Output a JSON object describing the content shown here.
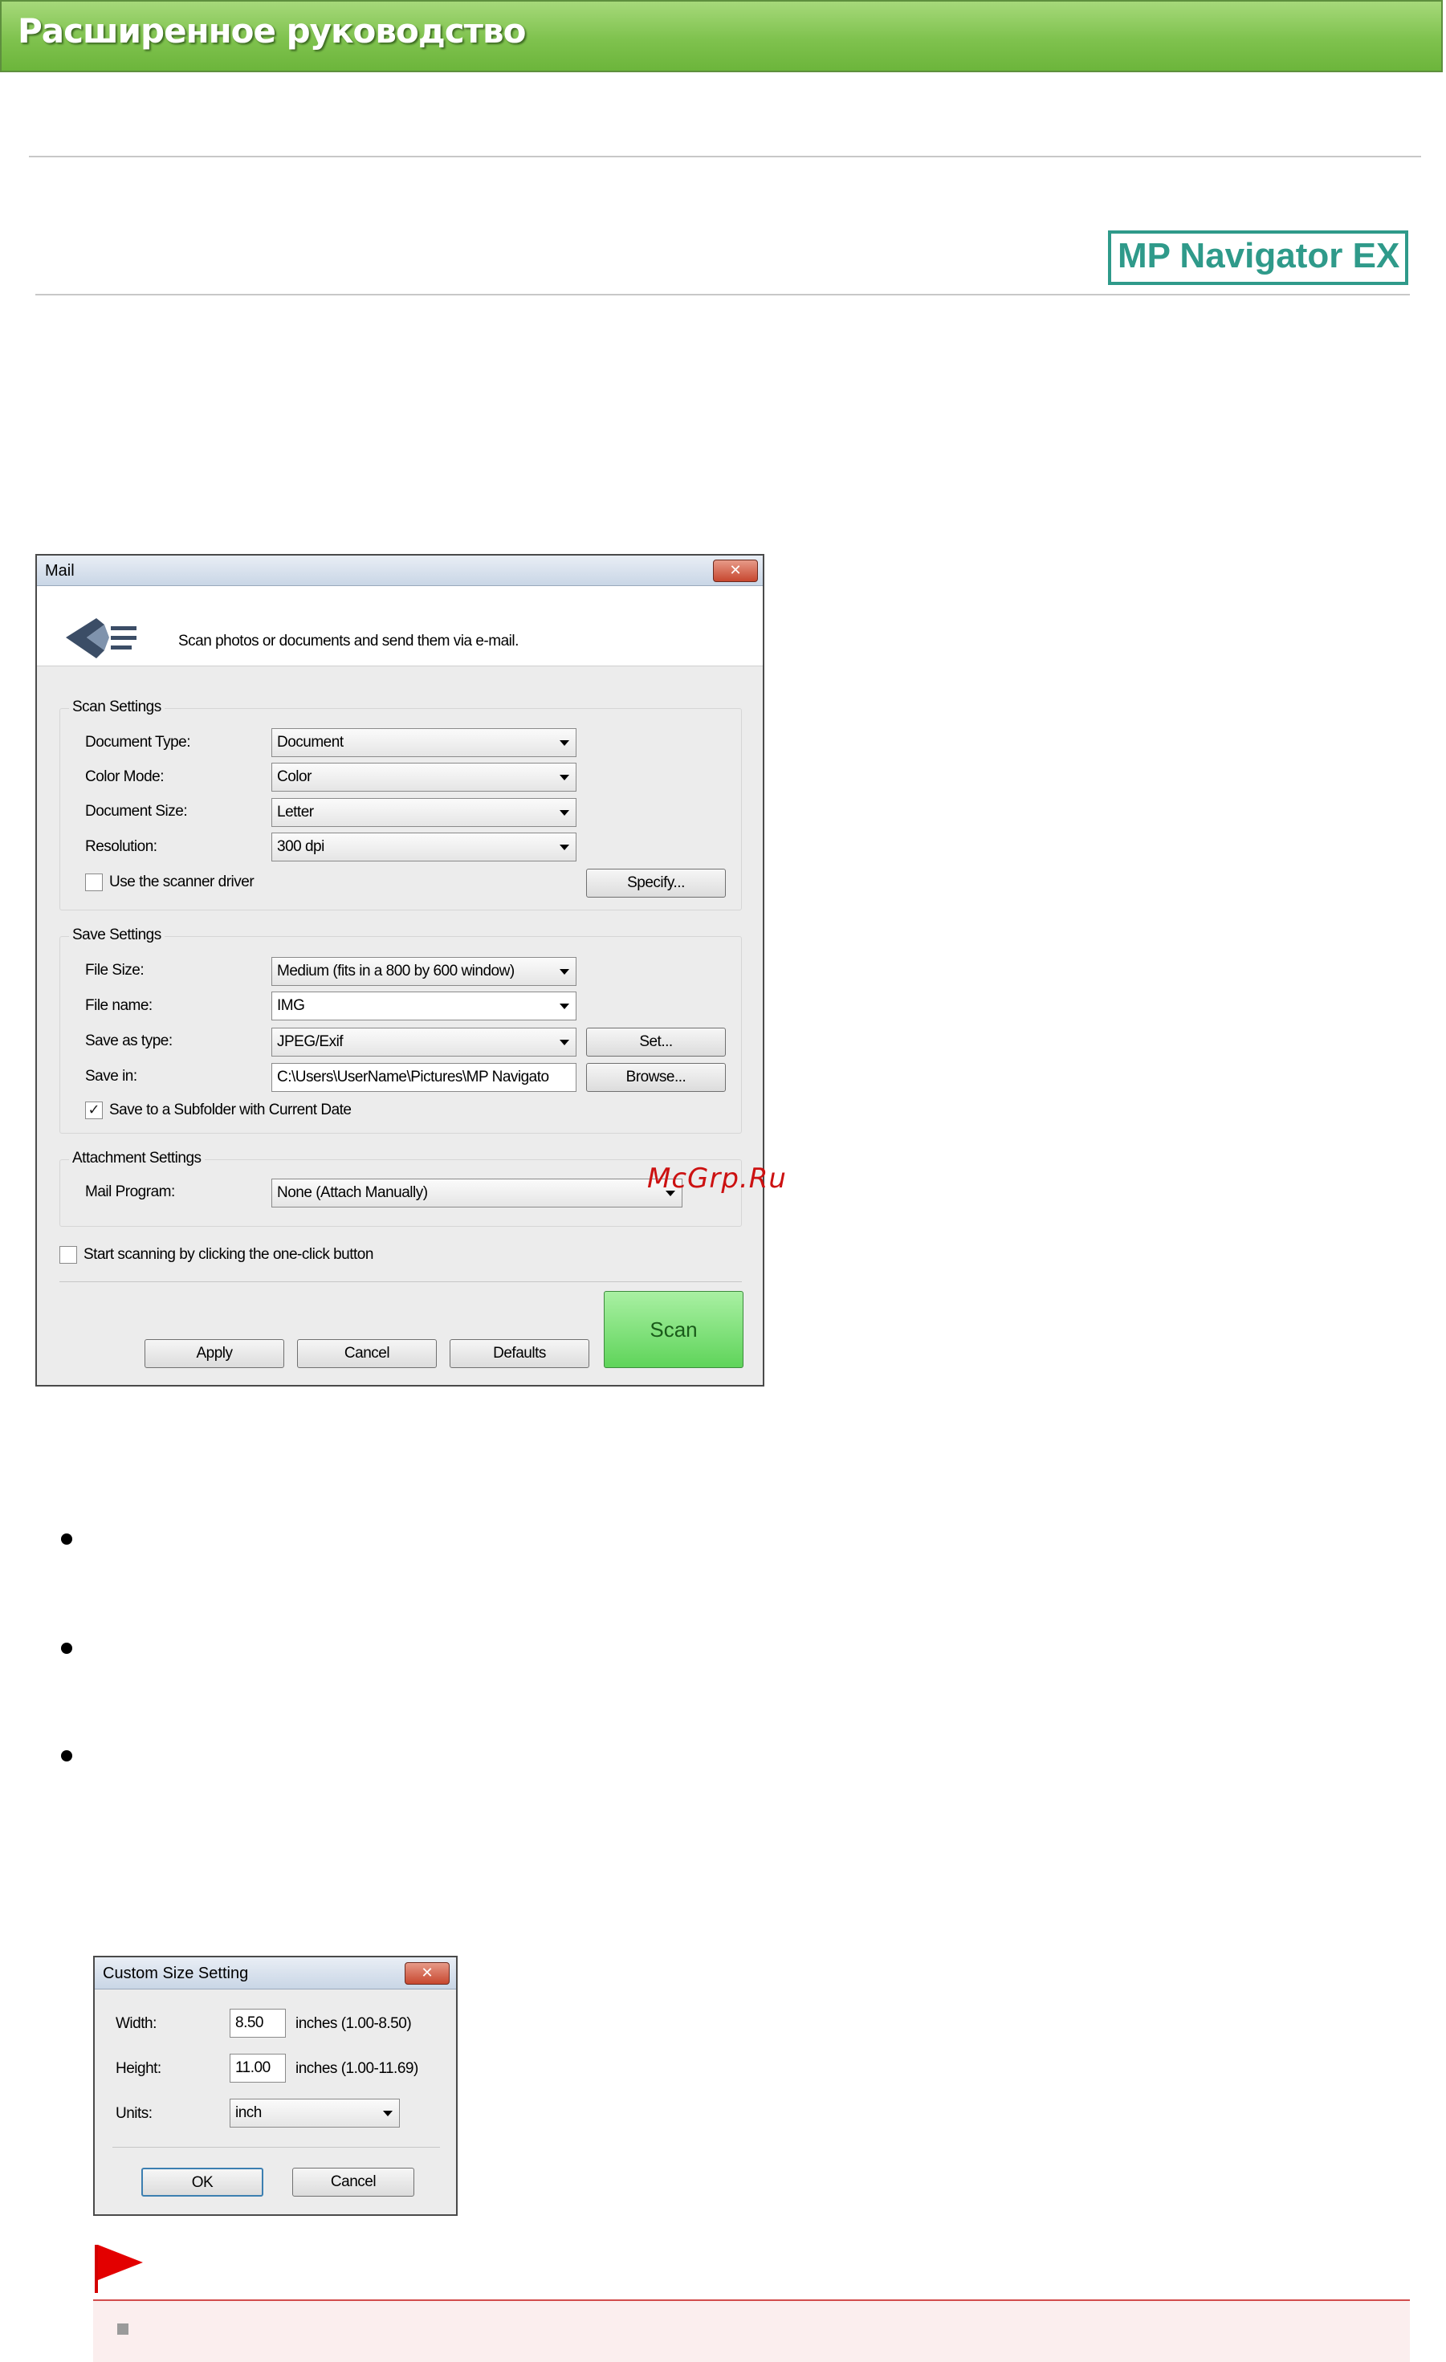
{
  "page": {
    "header_title": "Расширенное руководство",
    "logo_text": "MP Navigator EX",
    "watermark": "McGrp.Ru"
  },
  "mail_dialog": {
    "title": "Mail",
    "close_glyph": "✕",
    "description": "Scan photos or documents and send them via e-mail.",
    "scan_settings": {
      "heading": "Scan Settings",
      "document_type_label": "Document Type:",
      "document_type_value": "Document",
      "color_mode_label": "Color Mode:",
      "color_mode_value": "Color",
      "document_size_label": "Document Size:",
      "document_size_value": "Letter",
      "resolution_label": "Resolution:",
      "resolution_value": "300 dpi",
      "use_scanner_driver_label": "Use the scanner driver",
      "use_scanner_driver_checked": false,
      "specify_button": "Specify..."
    },
    "save_settings": {
      "heading": "Save Settings",
      "file_size_label": "File Size:",
      "file_size_value": "Medium (fits in a 800 by 600 window)",
      "file_name_label": "File name:",
      "file_name_value": "IMG",
      "save_as_type_label": "Save as type:",
      "save_as_type_value": "JPEG/Exif",
      "set_button": "Set...",
      "save_in_label": "Save in:",
      "save_in_value": "C:\\Users\\UserName\\Pictures\\MP Navigato",
      "browse_button": "Browse...",
      "subfolder_label": "Save to a Subfolder with Current Date",
      "subfolder_checked": true
    },
    "attachment_settings": {
      "heading": "Attachment Settings",
      "mail_program_label": "Mail Program:",
      "mail_program_value": "None (Attach Manually)"
    },
    "one_click_label": "Start scanning by clicking the one-click button",
    "one_click_checked": false,
    "apply_button": "Apply",
    "cancel_button": "Cancel",
    "defaults_button": "Defaults",
    "scan_button": "Scan"
  },
  "custom_size_dialog": {
    "title": "Custom Size Setting",
    "close_glyph": "✕",
    "width_label": "Width:",
    "width_value": "8.50",
    "width_range": "inches (1.00-8.50)",
    "height_label": "Height:",
    "height_value": "11.00",
    "height_range": "inches (1.00-11.69)",
    "units_label": "Units:",
    "units_value": "inch",
    "ok_button": "OK",
    "cancel_button": "Cancel"
  },
  "colors": {
    "header_green": "#7fc24e",
    "logo_teal": "#2f9a8a",
    "scan_green": "#5fd45a",
    "flag_red": "#e30000",
    "note_bg": "#fbeeee"
  },
  "icons": [
    "mail-scan-icon",
    "close-icon",
    "dropdown-arrow-icon",
    "checkbox-icon",
    "bullet-icon",
    "important-flag-icon"
  ]
}
